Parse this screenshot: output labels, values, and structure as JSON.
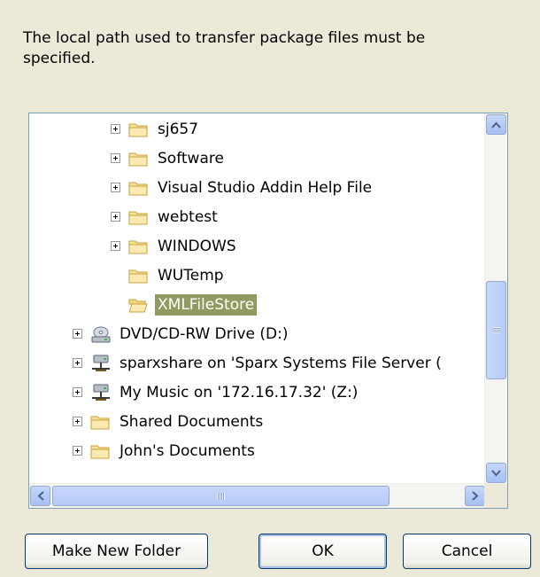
{
  "dialog": {
    "description": "The local path used to transfer package files must be specified."
  },
  "tree": {
    "items": [
      {
        "label": "sj657",
        "icon": "folder-icon",
        "expandable": true,
        "indent": 1
      },
      {
        "label": "Software",
        "icon": "folder-icon",
        "expandable": true,
        "indent": 1
      },
      {
        "label": "Visual Studio Addin Help File",
        "icon": "folder-icon",
        "expandable": true,
        "indent": 1
      },
      {
        "label": "webtest",
        "icon": "folder-icon",
        "expandable": true,
        "indent": 1
      },
      {
        "label": "WINDOWS",
        "icon": "folder-icon",
        "expandable": true,
        "indent": 1
      },
      {
        "label": "WUTemp",
        "icon": "folder-icon",
        "expandable": false,
        "indent": 1
      },
      {
        "label": "XMLFileStore",
        "icon": "folder-open-icon",
        "expandable": false,
        "indent": 1,
        "selected": true
      },
      {
        "label": "DVD/CD-RW Drive (D:)",
        "icon": "cd-drive-icon",
        "expandable": true,
        "indent": 0
      },
      {
        "label": "sparxshare on 'Sparx Systems File Server (",
        "icon": "network-drive-icon",
        "expandable": true,
        "indent": 0
      },
      {
        "label": "My Music on '172.16.17.32' (Z:)",
        "icon": "network-drive-icon",
        "expandable": true,
        "indent": 0
      },
      {
        "label": "Shared Documents",
        "icon": "folder-icon",
        "expandable": true,
        "indent": 0
      },
      {
        "label": "John's Documents",
        "icon": "folder-icon",
        "expandable": true,
        "indent": 0
      }
    ]
  },
  "buttons": {
    "make_new_folder": "Make New Folder",
    "ok": "OK",
    "cancel": "Cancel"
  },
  "colors": {
    "dialog_bg": "#ECE9D8",
    "selection": "#919B5F",
    "button_border": "#003C74",
    "tree_border": "#7F9DB9"
  }
}
